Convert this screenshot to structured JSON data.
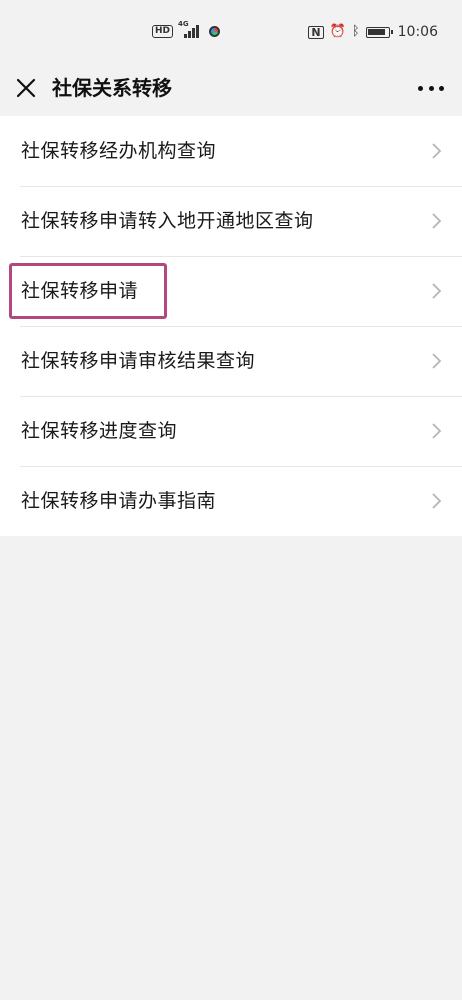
{
  "status_bar": {
    "hd_label": "HD",
    "network_label": "4G",
    "nfc_label": "N",
    "time": "10:06"
  },
  "header": {
    "title": "社保关系转移"
  },
  "menu": {
    "items": [
      {
        "label": "社保转移经办机构查询"
      },
      {
        "label": "社保转移申请转入地开通地区查询"
      },
      {
        "label": "社保转移申请",
        "highlighted": true
      },
      {
        "label": "社保转移申请审核结果查询"
      },
      {
        "label": "社保转移进度查询"
      },
      {
        "label": "社保转移申请办事指南"
      }
    ]
  },
  "colors": {
    "page_background": "#f2f2f2",
    "list_background": "#ffffff",
    "highlight_border": "#b3487f",
    "chevron": "#b5b5b5"
  }
}
